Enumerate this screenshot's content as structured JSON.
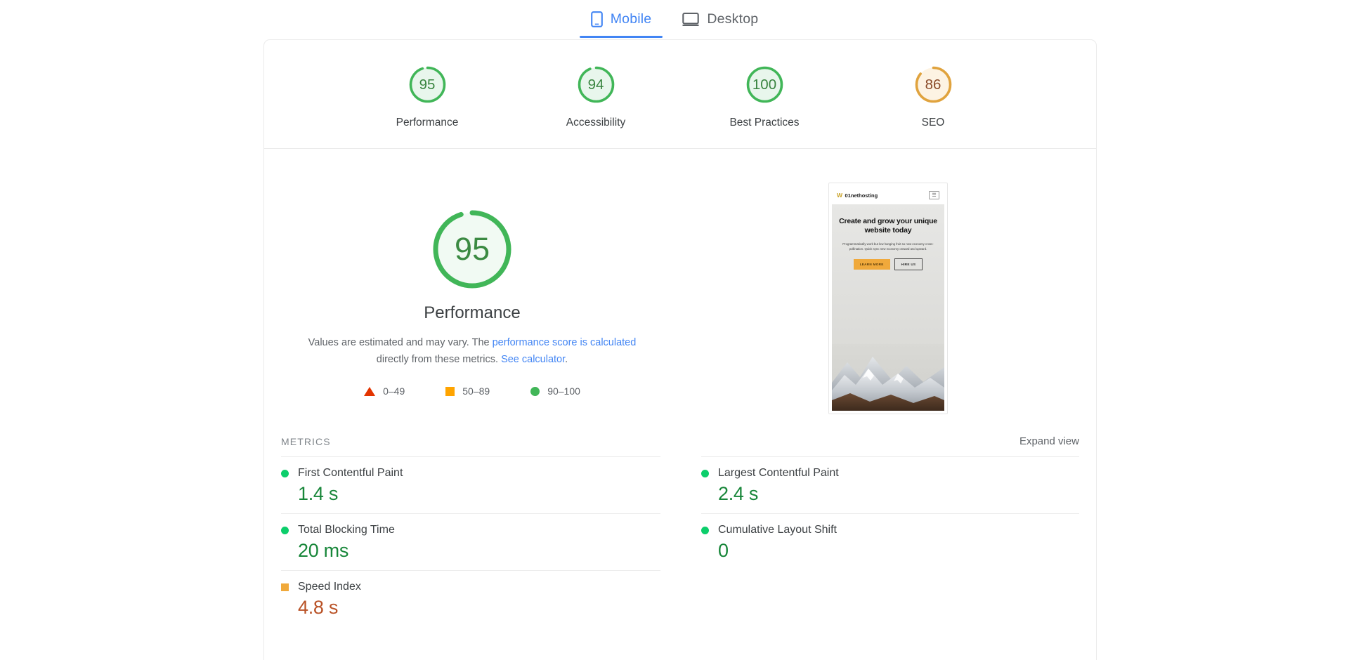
{
  "tabs": [
    {
      "label": "Mobile",
      "icon": "mobile-icon",
      "active": true
    },
    {
      "label": "Desktop",
      "icon": "desktop-icon",
      "active": false
    }
  ],
  "colors": {
    "pass": "#0cce6b",
    "pass_text": "#0d7a3e",
    "average": "#ffa400",
    "average_text": "#b95000",
    "fail": "#e33400",
    "link": "#4285f4",
    "gauge_green_track": "#e8f6ec",
    "gauge_orange_track": "#fdf3e3",
    "brand_gold": "#c9a227"
  },
  "scores": [
    {
      "value": "95",
      "label": "Performance",
      "percent": 95,
      "state": "pass"
    },
    {
      "value": "94",
      "label": "Accessibility",
      "percent": 94,
      "state": "pass"
    },
    {
      "value": "100",
      "label": "Best Practices",
      "percent": 100,
      "state": "pass"
    },
    {
      "value": "86",
      "label": "SEO",
      "percent": 86,
      "state": "average"
    }
  ],
  "hero": {
    "score": "95",
    "percent": 95,
    "state": "pass",
    "title": "Performance",
    "desc_part1": "Values are estimated and may vary. The ",
    "desc_link1": "performance score is calculated",
    "desc_part2": " directly from these metrics. ",
    "desc_link2": "See calculator",
    "desc_part3": "."
  },
  "legend": [
    {
      "shape": "triangle",
      "range": "0–49",
      "color": "#e33400"
    },
    {
      "shape": "square",
      "range": "50–89",
      "color": "#ffa400"
    },
    {
      "shape": "circle",
      "range": "90–100",
      "color": "#41b658"
    }
  ],
  "thumbnail": {
    "logo_mark": "W",
    "brand": "01nethosting",
    "menu_icon": "hamburger-icon",
    "headline": "Create and grow your unique website today",
    "body": "Programmatically work but low hanging fruit so new economy cross-pollination. Quick sync new economy onward and upward.",
    "cta_primary": "LEARN MORE",
    "cta_secondary": "HIRE US"
  },
  "metrics_section": {
    "title": "METRICS",
    "expand_label": "Expand view"
  },
  "metrics": {
    "left": [
      {
        "name": "First Contentful Paint",
        "value": "1.4 s",
        "state": "pass",
        "marker": "circle"
      },
      {
        "name": "Total Blocking Time",
        "value": "20 ms",
        "state": "pass",
        "marker": "circle"
      },
      {
        "name": "Speed Index",
        "value": "4.8 s",
        "state": "average",
        "marker": "square"
      }
    ],
    "right": [
      {
        "name": "Largest Contentful Paint",
        "value": "2.4 s",
        "state": "pass",
        "marker": "circle"
      },
      {
        "name": "Cumulative Layout Shift",
        "value": "0",
        "state": "pass",
        "marker": "circle"
      }
    ]
  }
}
